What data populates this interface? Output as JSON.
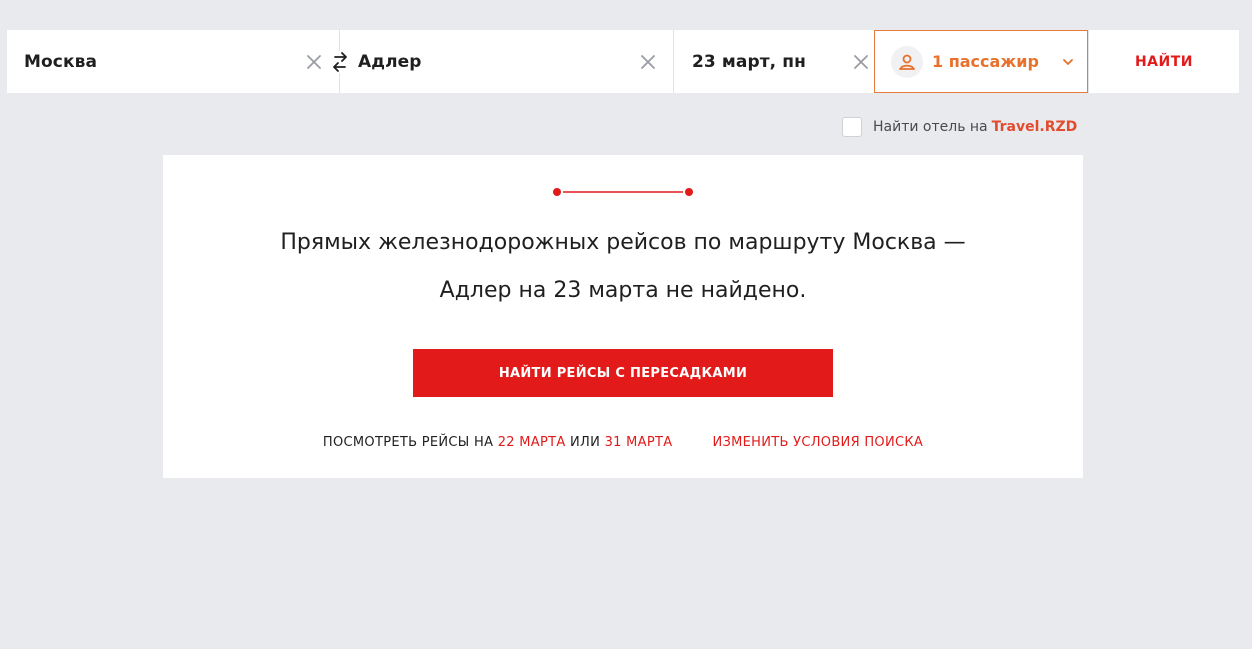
{
  "search": {
    "from": "Москва",
    "to": "Адлер",
    "date": "23 март, пн",
    "passengers": "1 пассажир",
    "find_label": "НАЙТИ"
  },
  "hotel": {
    "label": "Найти отель на",
    "link": "Travel.RZD"
  },
  "result": {
    "message_line1": "Прямых железнодорожных рейсов по маршруту Москва —",
    "message_line2": "Адлер на 23 марта не найдено.",
    "transfer_button": "НАЙТИ РЕЙСЫ С ПЕРЕСАДКАМИ",
    "see_flights_prefix": "ПОСМОТРЕТЬ РЕЙСЫ НА",
    "date_option_1": "22 МАРТА",
    "or_word": "ИЛИ",
    "date_option_2": "31 МАРТА",
    "change_search": "ИЗМЕНИТЬ УСЛОВИЯ ПОИСКА"
  },
  "colors": {
    "accent_red": "#e21a1a",
    "accent_orange": "#e8712d",
    "background": "#e9eaee"
  },
  "icons": {
    "clear": "close-icon",
    "swap": "swap-arrows-icon",
    "passenger": "user-icon",
    "dropdown": "chevron-down-icon"
  }
}
